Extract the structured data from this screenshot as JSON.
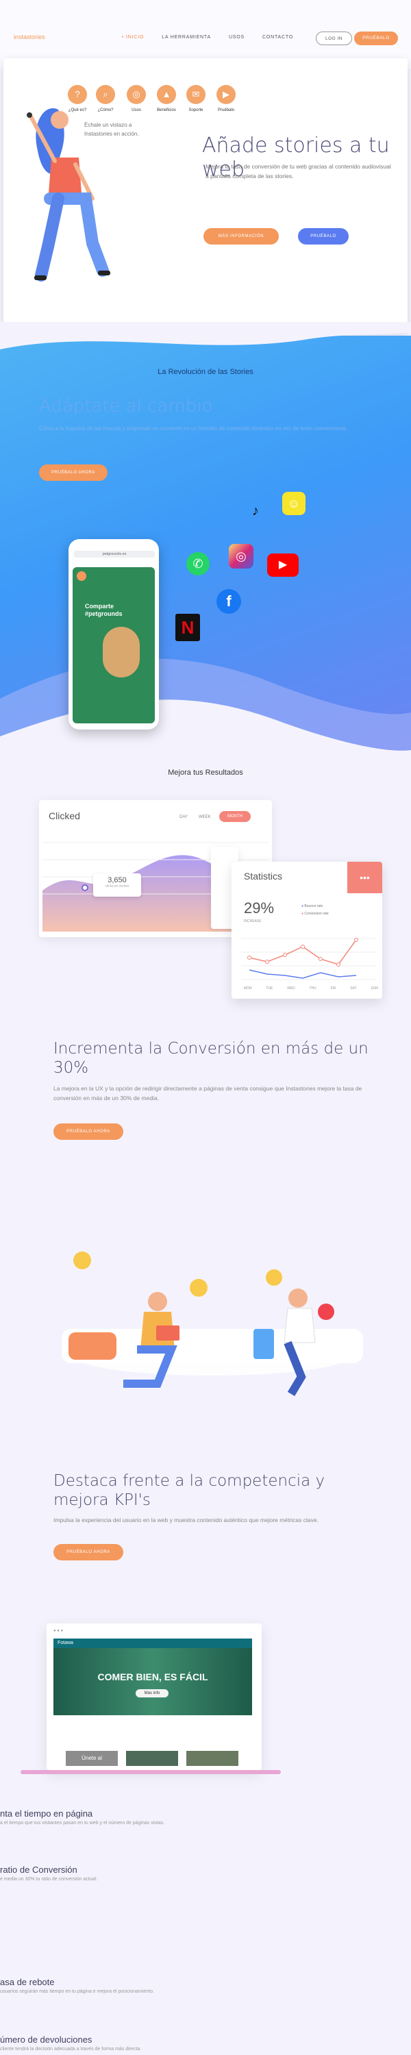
{
  "header": {
    "logo": "instastories",
    "nav": [
      "• INICIO",
      "LA HERRAMIENTA",
      "USOS",
      "CONTACTO"
    ],
    "login": "LOG IN",
    "try": "PRUÉBALO"
  },
  "hero": {
    "icons": [
      {
        "label": "¿Qué es?",
        "icon": "question-icon"
      },
      {
        "label": "¿Cómo?",
        "icon": "search-icon"
      },
      {
        "label": "Usos",
        "icon": "target-icon"
      },
      {
        "label": "Beneficios",
        "icon": "chart-icon"
      },
      {
        "label": "Soporte",
        "icon": "chat-icon"
      },
      {
        "label": "Pruébalo",
        "icon": "play-icon"
      }
    ],
    "note": "Échale un vistazo a Instastories en acción.",
    "title": "Añade stories a tu web",
    "description": "Mejora la tasa de conversión de tu web gracias al contenido audiovisual a pantalla completa de las stories.",
    "more_button": "MÁS INFORMACIÓN",
    "try_button": "PRUÉBALO"
  },
  "revolution": {
    "heading": "La Revolución de las Stories",
    "title": "Adáptate al cambio",
    "description": "Cómo a la mayoría de las marcas y empresas se convierte en un formato de contenido dinámico en vez de texto convencional.",
    "button": "PRUÉBALO AHORA",
    "phone_url": "petgrounds.es",
    "phone_story_text": "Comparte #petgrounds",
    "social": [
      "tiktok-icon",
      "snapchat-icon",
      "whatsapp-icon",
      "instagram-icon",
      "youtube-icon",
      "facebook-icon",
      "netflix-icon"
    ]
  },
  "results": {
    "heading": "Mejora tus Resultados",
    "clicked_card": {
      "title": "Clicked",
      "filters": [
        "DAY",
        "WEEK"
      ],
      "active_filter": "MONTH",
      "value": "3,650",
      "value_caption": "clicks en stories"
    },
    "stats_card": {
      "title": "Statistics",
      "percent": "29%",
      "percent_caption": "INCREASE",
      "legend": [
        "Bounce rate",
        "Conversion rate"
      ],
      "days": [
        "MON",
        "TUE",
        "WED",
        "THU",
        "FRI",
        "SAT",
        "SUN"
      ]
    },
    "title": "Incrementa la Conversión en más de un 30%",
    "description": "La mejora en la UX y la opción de redirigir directamente a páginas de venta consigue que Instastories mejore la tasa de conversión en más de un 30% de media.",
    "button": "PRUÉBALO AHORA"
  },
  "compete": {
    "title": "Destaca frente a la competencia y mejora KPI's",
    "description": "Impulsa la experiencia del usuario en la web y muestra contenido auténtico que mejore métricas clave.",
    "button": "PRUÉBALO AHORA",
    "browser_brand": "Fotawa",
    "banner_text": "COMER BIEN, ES FÁCIL",
    "banner_button": "Más info",
    "card_text": "Únete al"
  },
  "kpis": [
    {
      "title": "nta el tiempo en página",
      "desc": "a el tiempo que tus visitantes pasan en tu web y el número de páginas vistas."
    },
    {
      "title": "ratio de Conversión",
      "desc": "e media un 30% tu ratio de conversión actual."
    },
    {
      "title": "asa de rebote",
      "desc": "usuarios seguirán más tiempo en tu página e mejora el posicionamiento."
    },
    {
      "title": "úmero de devoluciones",
      "desc": "cliente tendrá la decisión adecuada a través de forma más directa."
    }
  ],
  "colors": {
    "accent": "#f4985c",
    "blue": "#3d9af8",
    "secondary": "#5b7cf0",
    "title": "#4d4b78"
  }
}
